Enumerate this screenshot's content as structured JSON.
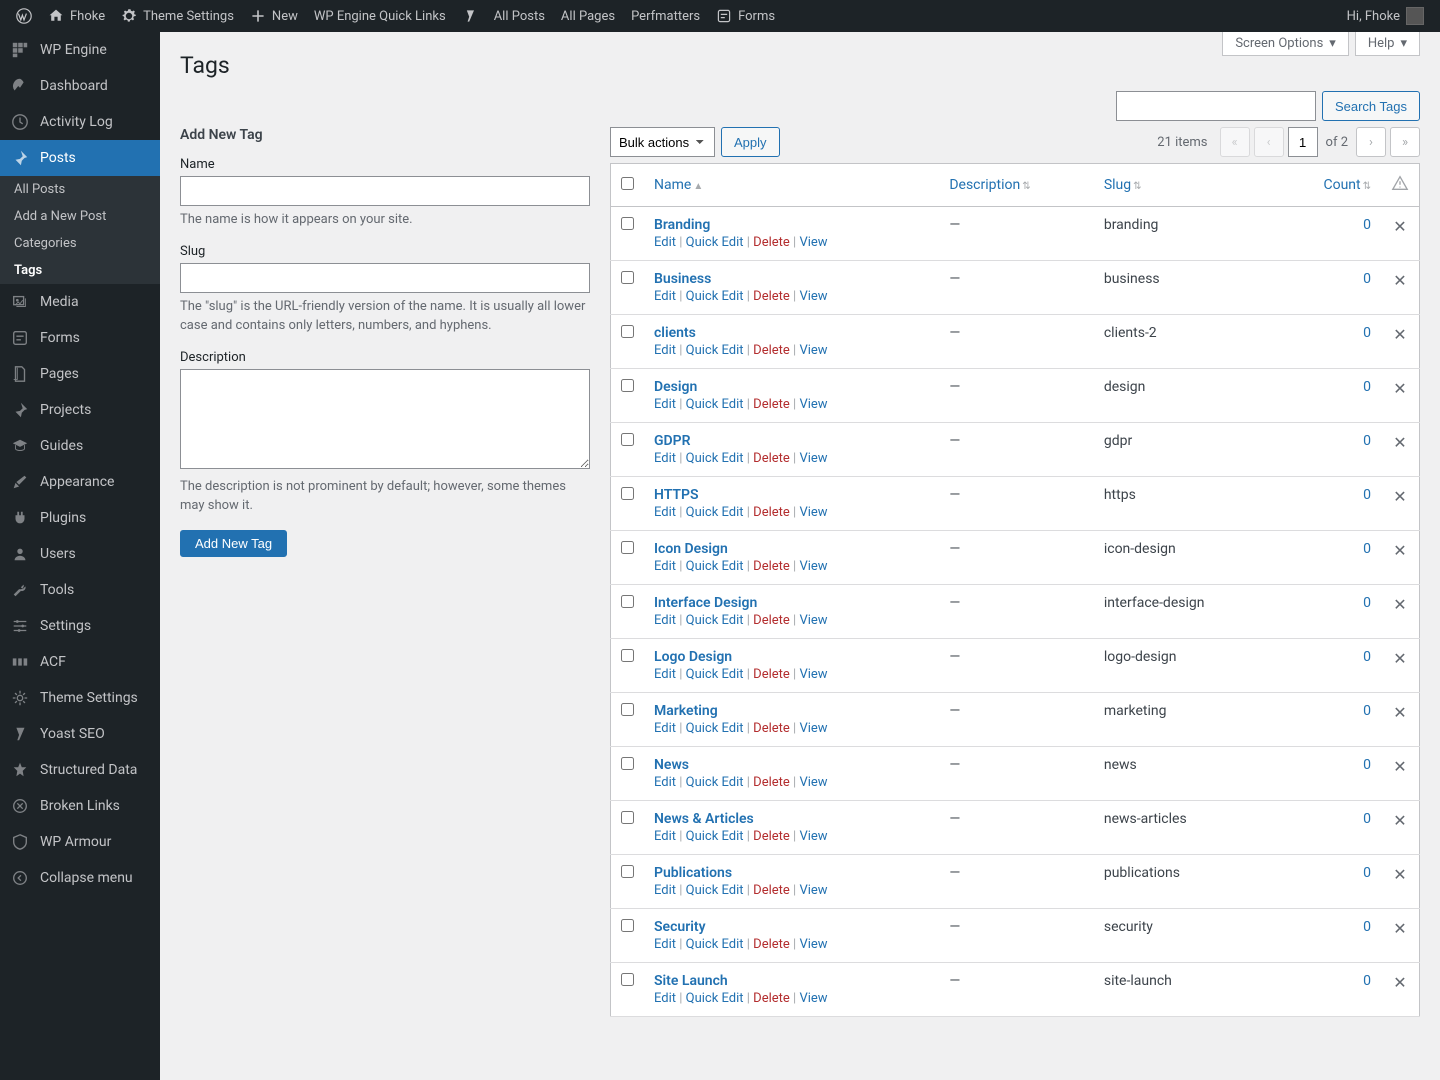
{
  "adminbar": {
    "site": "Fhoke",
    "theme_settings": "Theme Settings",
    "new": "New",
    "wp_engine": "WP Engine Quick Links",
    "all_posts": "All Posts",
    "all_pages": "All Pages",
    "perfmatters": "Perfmatters",
    "forms": "Forms",
    "greeting": "Hi, Fhoke"
  },
  "menu": {
    "wp_engine": "WP Engine",
    "dashboard": "Dashboard",
    "activity_log": "Activity Log",
    "posts": "Posts",
    "posts_sub": {
      "all": "All Posts",
      "add": "Add a New Post",
      "categories": "Categories",
      "tags": "Tags"
    },
    "media": "Media",
    "forms": "Forms",
    "pages": "Pages",
    "projects": "Projects",
    "guides": "Guides",
    "appearance": "Appearance",
    "plugins": "Plugins",
    "users": "Users",
    "tools": "Tools",
    "settings": "Settings",
    "acf": "ACF",
    "theme_settings": "Theme Settings",
    "yoast": "Yoast SEO",
    "structured_data": "Structured Data",
    "broken_links": "Broken Links",
    "wp_armour": "WP Armour",
    "collapse": "Collapse menu"
  },
  "screen_meta": {
    "screen_options": "Screen Options",
    "help": "Help"
  },
  "page_title": "Tags",
  "search": {
    "button": "Search Tags"
  },
  "form": {
    "heading": "Add New Tag",
    "name_label": "Name",
    "name_desc": "The name is how it appears on your site.",
    "slug_label": "Slug",
    "slug_desc": "The \"slug\" is the URL-friendly version of the name. It is usually all lower case and contains only letters, numbers, and hyphens.",
    "desc_label": "Description",
    "desc_desc": "The description is not prominent by default; however, some themes may show it.",
    "submit": "Add New Tag"
  },
  "tablenav": {
    "bulk_actions": "Bulk actions",
    "apply": "Apply",
    "items_count": "21 items",
    "current_page": "1",
    "total_pages": "of 2"
  },
  "columns": {
    "name": "Name",
    "description": "Description",
    "slug": "Slug",
    "count": "Count"
  },
  "row_actions": {
    "edit": "Edit",
    "quick_edit": "Quick Edit",
    "delete": "Delete",
    "view": "View"
  },
  "rows": [
    {
      "name": "Branding",
      "description": "—",
      "slug": "branding",
      "count": "0"
    },
    {
      "name": "Business",
      "description": "—",
      "slug": "business",
      "count": "0"
    },
    {
      "name": "clients",
      "description": "—",
      "slug": "clients-2",
      "count": "0"
    },
    {
      "name": "Design",
      "description": "—",
      "slug": "design",
      "count": "0"
    },
    {
      "name": "GDPR",
      "description": "—",
      "slug": "gdpr",
      "count": "0"
    },
    {
      "name": "HTTPS",
      "description": "—",
      "slug": "https",
      "count": "0"
    },
    {
      "name": "Icon Design",
      "description": "—",
      "slug": "icon-design",
      "count": "0"
    },
    {
      "name": "Interface Design",
      "description": "—",
      "slug": "interface-design",
      "count": "0"
    },
    {
      "name": "Logo Design",
      "description": "—",
      "slug": "logo-design",
      "count": "0"
    },
    {
      "name": "Marketing",
      "description": "—",
      "slug": "marketing",
      "count": "0"
    },
    {
      "name": "News",
      "description": "—",
      "slug": "news",
      "count": "0"
    },
    {
      "name": "News & Articles",
      "description": "—",
      "slug": "news-articles",
      "count": "0"
    },
    {
      "name": "Publications",
      "description": "—",
      "slug": "publications",
      "count": "0"
    },
    {
      "name": "Security",
      "description": "—",
      "slug": "security",
      "count": "0"
    },
    {
      "name": "Site Launch",
      "description": "—",
      "slug": "site-launch",
      "count": "0"
    }
  ]
}
